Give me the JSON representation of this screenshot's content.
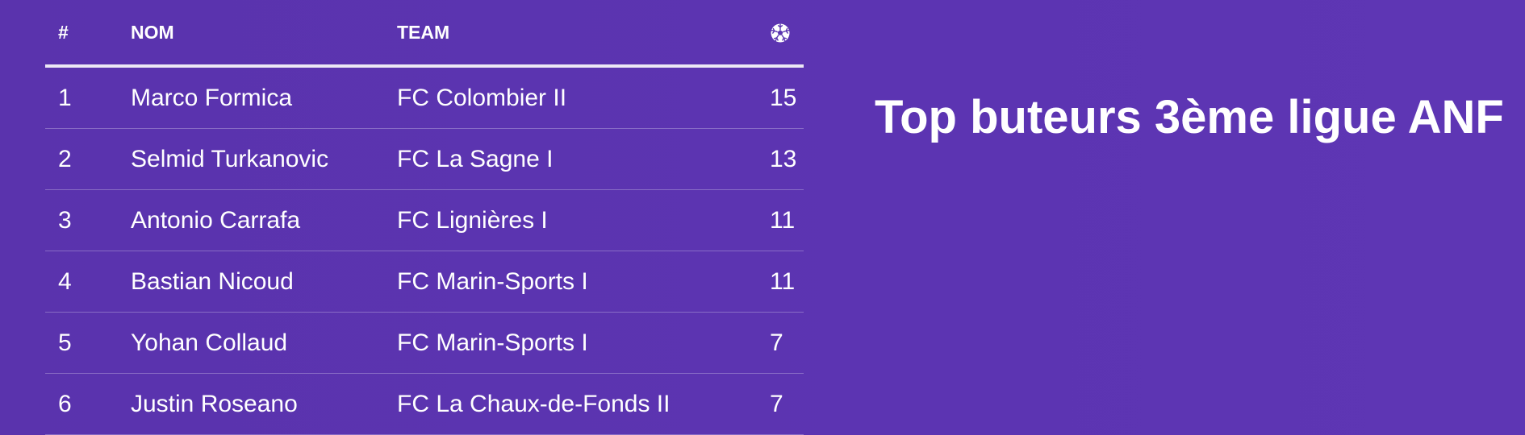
{
  "title": "Top buteurs 3ème ligue ANF",
  "table": {
    "headers": {
      "rank": "#",
      "name": "NOM",
      "team": "TEAM",
      "goals_icon": "soccer-ball-icon"
    },
    "rows": [
      {
        "rank": "1",
        "name": "Marco Formica",
        "team": "FC Colombier II",
        "goals": "15"
      },
      {
        "rank": "2",
        "name": "Selmid Turkanovic",
        "team": "FC La Sagne I",
        "goals": "13"
      },
      {
        "rank": "3",
        "name": "Antonio Carrafa",
        "team": "FC Lignières I",
        "goals": "11"
      },
      {
        "rank": "4",
        "name": "Bastian Nicoud",
        "team": "FC Marin-Sports I",
        "goals": "11"
      },
      {
        "rank": "5",
        "name": "Yohan Collaud",
        "team": "FC Marin-Sports I",
        "goals": "7"
      },
      {
        "rank": "6",
        "name": "Justin Roseano",
        "team": "FC La Chaux-de-Fonds II",
        "goals": "7"
      }
    ]
  },
  "colors": {
    "background": "#5a34b0",
    "text": "#ffffff"
  }
}
